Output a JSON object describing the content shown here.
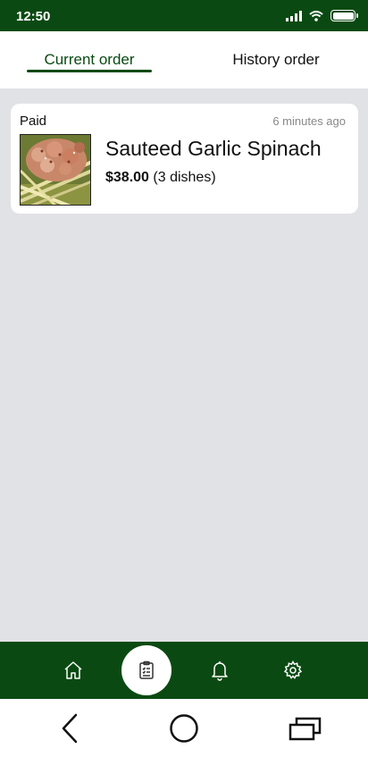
{
  "status_bar": {
    "time": "12:50",
    "icons": [
      "signal-icon",
      "wifi-icon",
      "battery-icon"
    ]
  },
  "tabs": [
    {
      "label": "Current order",
      "active": true
    },
    {
      "label": "History order",
      "active": false
    }
  ],
  "orders": [
    {
      "status": "Paid",
      "time_ago": "6 minutes ago",
      "name": "Sauteed Garlic Spinach",
      "price": "$38.00",
      "dishes": "(3 dishes)",
      "image": "food-photo"
    }
  ],
  "bottom_nav": {
    "items": [
      {
        "icon": "home-icon",
        "active": false
      },
      {
        "icon": "orders-clipboard-icon",
        "active": true
      },
      {
        "icon": "bell-icon",
        "active": false
      },
      {
        "icon": "gear-icon",
        "active": false
      }
    ]
  },
  "system_nav": [
    "back-icon",
    "home-circle-icon",
    "recent-apps-icon"
  ],
  "colors": {
    "primary": "#0a4a12",
    "background": "#e1e2e6",
    "card": "#ffffff",
    "muted_text": "#888888"
  }
}
